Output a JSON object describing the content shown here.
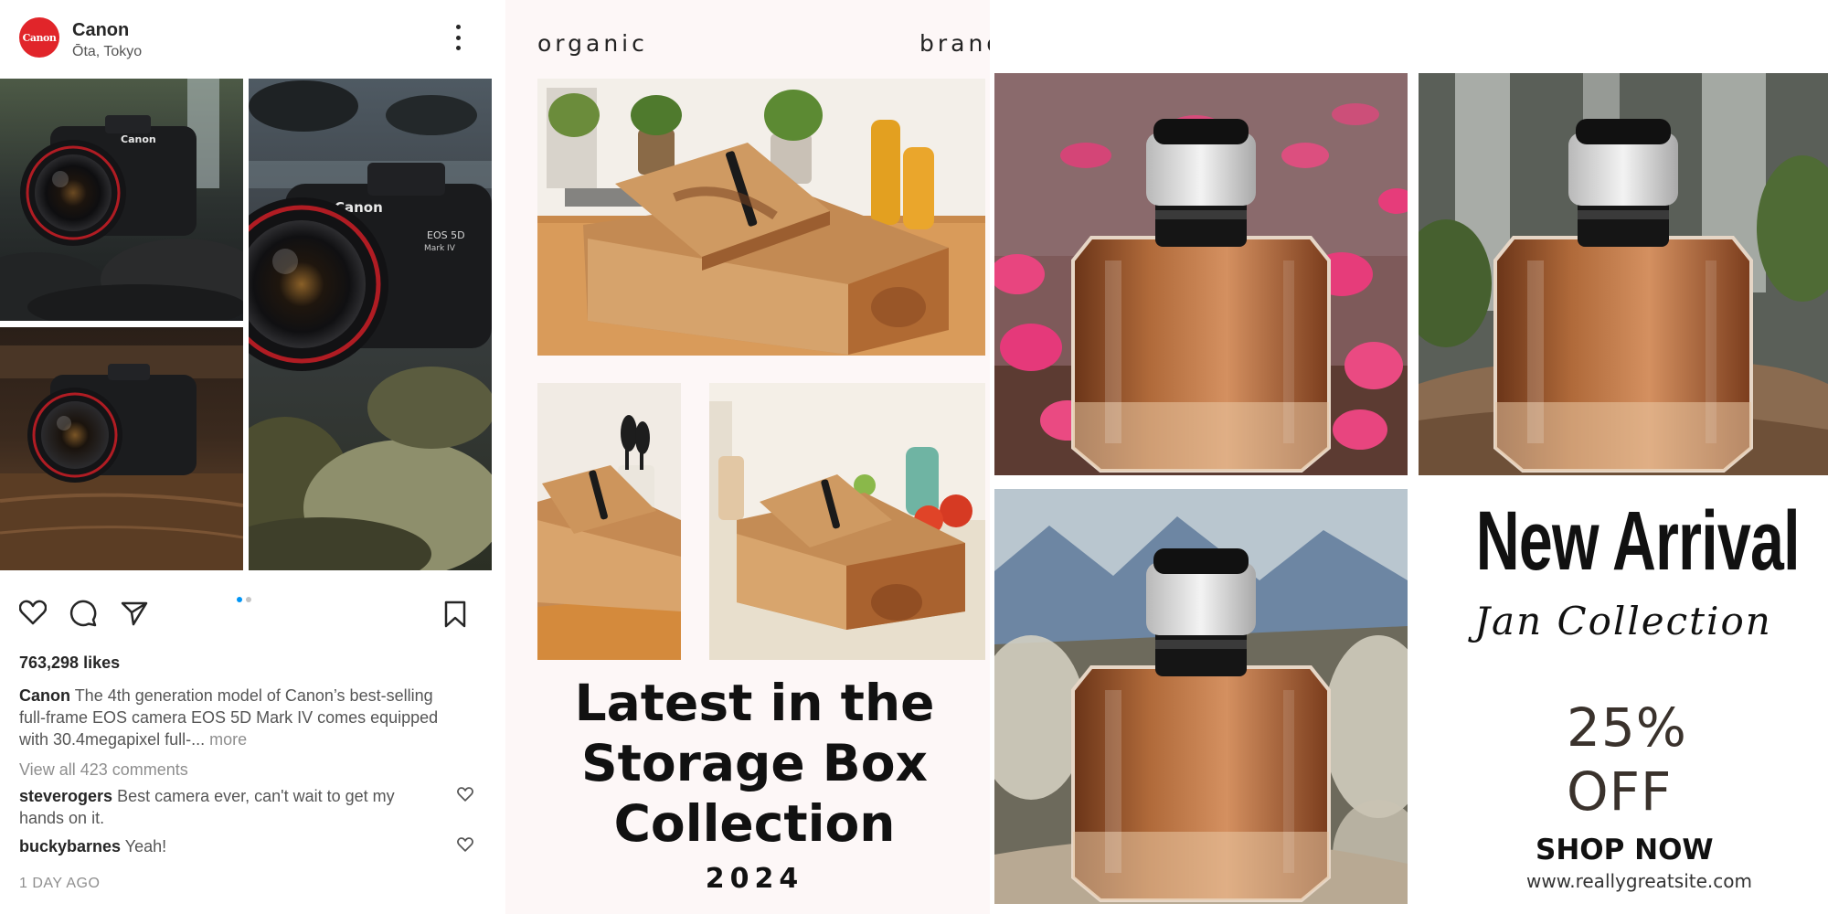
{
  "instagram": {
    "avatar_text": "Canon",
    "username": "Canon",
    "location": "Ōta, Tokyo",
    "icons": [
      "more-vertical-icon",
      "heart-icon",
      "comment-icon",
      "share-icon",
      "bookmark-icon"
    ],
    "carousel": {
      "total": 2,
      "active": 1
    },
    "likes": "763,298 likes",
    "caption_user": "Canon",
    "caption_text": "The 4th generation model of Canon’s best-selling full-frame EOS camera EOS 5D Mark IV comes equipped with 30.4megapixel full-...",
    "caption_more": "more",
    "view_all": "View all 423 comments",
    "comments": [
      {
        "user": "steverogers",
        "text": "Best camera ever, can't wait to get my hands on it."
      },
      {
        "user": "buckybarnes",
        "text": "Yeah!"
      }
    ],
    "time_ago": "1 DAY AGO",
    "photo_labels": {
      "brand": "Canon",
      "model": "EOS 5D",
      "mark": "Mark IV"
    }
  },
  "storage_poster": {
    "brand_left": "organic",
    "brand_right": "brand",
    "title_lines": [
      "Latest in the",
      "Storage Box",
      "Collection"
    ],
    "year": "2024"
  },
  "perfume_poster": {
    "headline": "New Arrival",
    "subheadline": "Jan Collection",
    "discount_percent": "25%",
    "discount_word": "OFF",
    "cta": "SHOP NOW",
    "website": "www.reallygreatsite.com"
  },
  "colors": {
    "canon_red": "#e1252a",
    "ig_blue": "#0095f6",
    "perfume_amber": "#b06a3a",
    "wood": "#c89466"
  }
}
